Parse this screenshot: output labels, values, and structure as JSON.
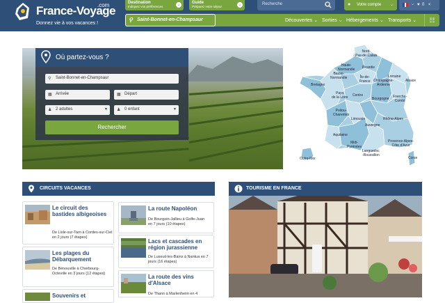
{
  "header": {
    "logo": {
      "name": "France-Voyage",
      "domain": ".com",
      "tagline": "Donnez vie à vos vacances !"
    },
    "destination": {
      "title": "Destination",
      "subtitle": "Indiquez vos préférences"
    },
    "guide": {
      "title": "Guide",
      "subtitle": "Préparez votre séjour"
    },
    "search": {
      "placeholder": "Recherche"
    },
    "account": {
      "label": "Votre compte"
    },
    "prefs": {
      "favorites": "0"
    }
  },
  "nav": {
    "location": "Saint-Bonnet-en-Champsaur",
    "items": [
      {
        "label": "Découvertes"
      },
      {
        "label": "Sorties"
      },
      {
        "label": "Hébergements"
      },
      {
        "label": "Transports"
      }
    ]
  },
  "search_form": {
    "heading": "Où partez-vous ?",
    "destination": "Saint-Bonnet-en-Champsaur",
    "arrival": "Arrivée",
    "departure": "Départ",
    "adults": "2 adultes",
    "children": "0 enfant",
    "submit": "Rechercher"
  },
  "map": {
    "regions": [
      {
        "label": "Nord-\nPas-de-Calais"
      },
      {
        "label": "Haute-\nNormandie"
      },
      {
        "label": "Picardie"
      },
      {
        "label": "Basse-\nNormandie"
      },
      {
        "label": "Île-de-\nFrance"
      },
      {
        "label": "Lorraine"
      },
      {
        "label": "Alsace"
      },
      {
        "label": "Bretagne"
      },
      {
        "label": "Champagne-\nArdenne"
      },
      {
        "label": "Pays\nde la Loire"
      },
      {
        "label": "Centre"
      },
      {
        "label": "Bourgogne"
      },
      {
        "label": "Franche-\nComté"
      },
      {
        "label": "Poitou-\nCharentes"
      },
      {
        "label": "Limousin"
      },
      {
        "label": "Auvergne"
      },
      {
        "label": "Rhône-Alpes"
      },
      {
        "label": "Aquitaine"
      },
      {
        "label": "Midi-\nPyrénées"
      },
      {
        "label": "Languedoc\n-Roussillon"
      },
      {
        "label": "Provence-Alpes-\nCôte d'Azur"
      },
      {
        "label": "Corse"
      },
      {
        "label": "Outre-Mer"
      }
    ]
  },
  "circuits": {
    "heading": "CIRCUITS VACANCES",
    "items": [
      {
        "title": "Le circuit des bastides albigeoises",
        "desc": "De Lisle-sur-Tarn à Cordes-sur-Ciel en 2 jours (7 étapes)"
      },
      {
        "title": "Les plages du Débarquement",
        "desc": "De Bénouville à Cherbourg-Octeville en 3 jours (12 étapes)"
      },
      {
        "title": "Souvenirs et",
        "desc": ""
      },
      {
        "title": "La route Napoléon",
        "desc": "De Bourgoin-Jallieu à Golfe-Juan en 7 jours (10 étapes)"
      },
      {
        "title": "Lacs et cascades en région jurassienne",
        "desc": "De Luxeuil-les-Bains à Nantua en 7 jours (16 étapes)"
      },
      {
        "title": "La route des vins d'Alsace",
        "desc": "De Thann à Marlenheim en 4"
      }
    ]
  },
  "tourism": {
    "heading": "TOURISME EN FRANCE"
  }
}
